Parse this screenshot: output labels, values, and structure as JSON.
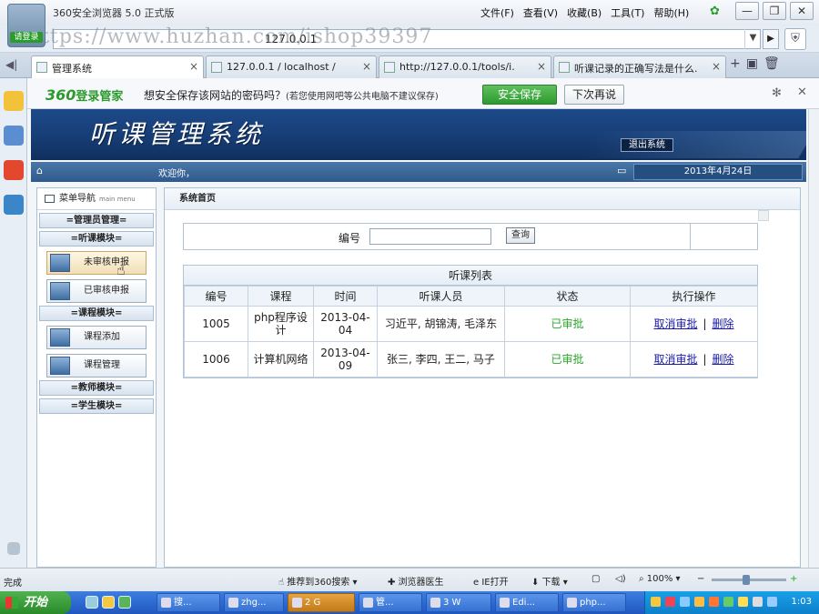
{
  "browser": {
    "title": "360安全浏览器 5.0 正式版",
    "logo_badge": "请登录",
    "menu": [
      "文件(F)",
      "查看(V)",
      "收藏(B)",
      "工具(T)",
      "帮助(H)"
    ],
    "window_controls": [
      "—",
      "❐",
      "✕"
    ],
    "url": "127.0.0.1",
    "watermark": "https://www.huzhan.com/ishop39397",
    "tabs": [
      {
        "label": "管理系统",
        "close": "×"
      },
      {
        "label": "127.0.0.1 / localhost /",
        "close": "×"
      },
      {
        "label": "http://127.0.0.1/tools/i.",
        "close": "×"
      },
      {
        "label": "听课记录的正确写法是什么.",
        "close": "×"
      }
    ]
  },
  "password_bar": {
    "brand_num": "360",
    "brand": "登录管家",
    "text": "想安全保存该网站的密码吗？",
    "note": "(若您使用网吧等公共电脑不建议保存)",
    "save_label": "安全保存",
    "later_label": "下次再说"
  },
  "app": {
    "title": "听课管理系统",
    "logout": "退出系统",
    "welcome": "欢迎你，",
    "date": "2013年4月24日",
    "menu_title": "菜单导航",
    "menu_title_en": "main menu",
    "menu": {
      "cat_admin": "=管理员管理=",
      "cat_listen": "=听课模块=",
      "btn_unreviewed": "未审核申报",
      "btn_reviewed": "已审核申报",
      "cat_course": "=课程模块=",
      "btn_course_add": "课程添加",
      "btn_course_manage": "课程管理",
      "cat_teacher": "=教师模块=",
      "cat_student": "=学生模块="
    },
    "breadcrumb": "系统首页",
    "search": {
      "label": "编号",
      "value": "",
      "button": "查询"
    },
    "list": {
      "title": "听课列表",
      "headers": [
        "编号",
        "课程",
        "时间",
        "听课人员",
        "状态",
        "执行操作"
      ],
      "rows": [
        {
          "id": "1005",
          "course": "php程序设计",
          "time": "2013-04-04",
          "people": "习近平, 胡锦涛, 毛泽东",
          "status": "已审批",
          "cancel": "取消审批",
          "sep": "|",
          "delete": "删除"
        },
        {
          "id": "1006",
          "course": "计算机网络",
          "time": "2013-04-09",
          "people": "张三, 李四, 王二, 马子",
          "status": "已审批",
          "cancel": "取消审批",
          "sep": "|",
          "delete": "删除"
        }
      ]
    }
  },
  "statusbar": {
    "status": "完成",
    "search360": "推荐到360搜索",
    "doctor": "浏览器医生",
    "ie_open": "IE打开",
    "download": "下载",
    "zoom": "100%"
  },
  "taskbar": {
    "start": "开始",
    "tasks": [
      "搜...",
      "zhg...",
      "2 G",
      "管...",
      "3 W",
      "Edi...",
      "php..."
    ],
    "clock": "1:03"
  },
  "colors": {
    "banner": "#1d4a8a",
    "status_green": "#2aa62a",
    "link_blue": "#1a1aa6",
    "taskbar": "#1f57c0"
  }
}
